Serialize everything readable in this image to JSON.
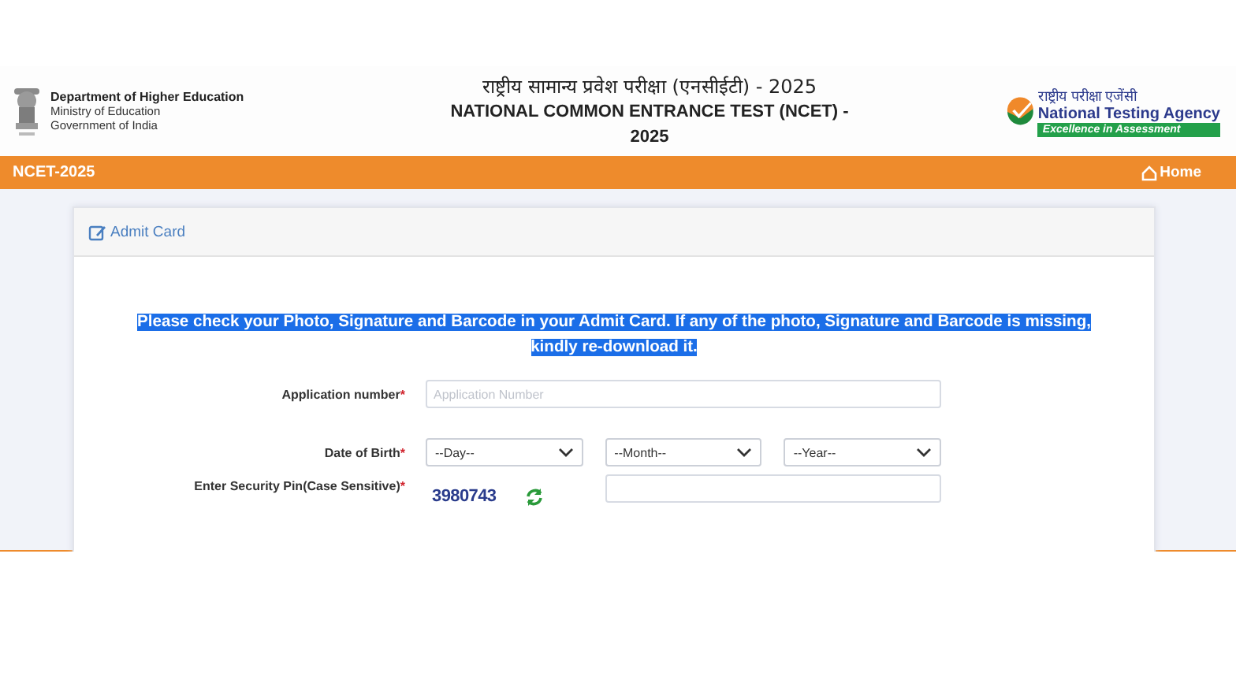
{
  "header": {
    "department": {
      "title": "Department of Higher Education",
      "lines": [
        "Ministry of Education",
        "Government of India"
      ]
    },
    "title_hindi": "राष्ट्रीय सामान्य प्रवेश परीक्षा (एनसीईटी) - 2025",
    "title_english": "NATIONAL COMMON ENTRANCE TEST (NCET) - 2025",
    "agency": {
      "hindi": "राष्ट्रीय परीक्षा एजेंसी",
      "name": "National Testing Agency",
      "tagline": "Excellence in Assessment"
    }
  },
  "navbar": {
    "brand": "NCET-2025",
    "home": "Home"
  },
  "card": {
    "title": "Admit Card",
    "notice": "Please check your Photo, Signature and Barcode in your Admit Card. If any of the photo, Signature and Barcode is missing, kindly re-download it.",
    "fields": [
      {
        "kind": "text",
        "label": "Application number",
        "required_mark": "*",
        "placeholder": "Application Number"
      },
      {
        "kind": "selects",
        "label": "Date of Birth",
        "required_mark": "*",
        "options": [
          "--Day--",
          "--Month--",
          "--Year--"
        ]
      },
      {
        "kind": "captcha",
        "label": "Enter Security Pin(Case Sensitive)",
        "required_mark": "*",
        "code": "3980743"
      }
    ]
  }
}
